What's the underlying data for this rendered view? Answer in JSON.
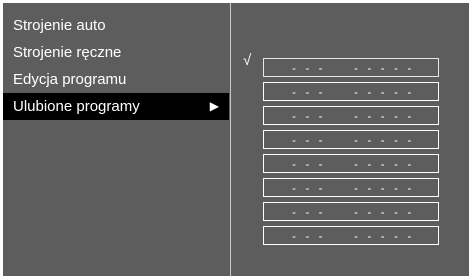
{
  "menu": {
    "items": [
      {
        "label": "Strojenie auto"
      },
      {
        "label": "Strojenie ręczne"
      },
      {
        "label": "Edycja programu"
      },
      {
        "label": "Ulubione programy",
        "arrow": "▶"
      }
    ],
    "selected_index": 3
  },
  "favorites": {
    "check_mark": "√",
    "slots": [
      {
        "ch": "- - -",
        "name": "- - - - -"
      },
      {
        "ch": "- - -",
        "name": "- - - - -"
      },
      {
        "ch": "- - -",
        "name": "- - - - -"
      },
      {
        "ch": "- - -",
        "name": "- - - - -"
      },
      {
        "ch": "- - -",
        "name": "- - - - -"
      },
      {
        "ch": "- - -",
        "name": "- - - - -"
      },
      {
        "ch": "- - -",
        "name": "- - - - -"
      },
      {
        "ch": "- - -",
        "name": "- - - - -"
      }
    ]
  }
}
